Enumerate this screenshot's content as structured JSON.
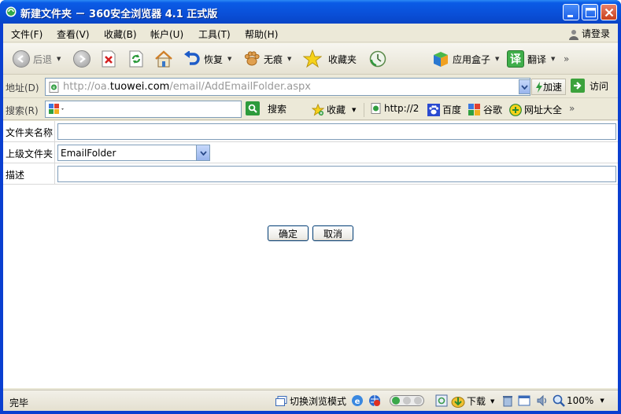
{
  "window": {
    "title": "新建文件夹 － 360安全浏览器 4.1 正式版"
  },
  "menu": {
    "items": [
      "文件(F)",
      "查看(V)",
      "收藏(B)",
      "帐户(U)",
      "工具(T)",
      "帮助(H)"
    ],
    "login": "请登录"
  },
  "toolbar": {
    "back": "后退",
    "restore": "恢复",
    "incognito": "无痕",
    "favorites": "收藏夹",
    "app_box": "应用盒子",
    "translate": "翻译",
    "more": "»"
  },
  "address": {
    "label": "地址(D)",
    "url_prefix": "http://oa.",
    "url_domain": "tuowei.com",
    "url_path": "/email/AddEmailFolder.aspx",
    "speed": "加速",
    "go": "访问"
  },
  "searchbar": {
    "label": "搜索(R)",
    "search_button": "搜索",
    "favorites": "收藏",
    "links": [
      "http://2",
      "百度",
      "谷歌",
      "网址大全"
    ],
    "more": "»"
  },
  "form": {
    "folder_name_label": "文件夹名称",
    "folder_name_value": "",
    "parent_label": "上级文件夹",
    "parent_value": "EmailFolder",
    "description_label": "描述",
    "description_value": "",
    "ok_button": "确定",
    "cancel_button": "取消"
  },
  "status": {
    "text": "完毕",
    "switch_mode": "切换浏览模式",
    "download": "下载",
    "zoom": "100%"
  }
}
